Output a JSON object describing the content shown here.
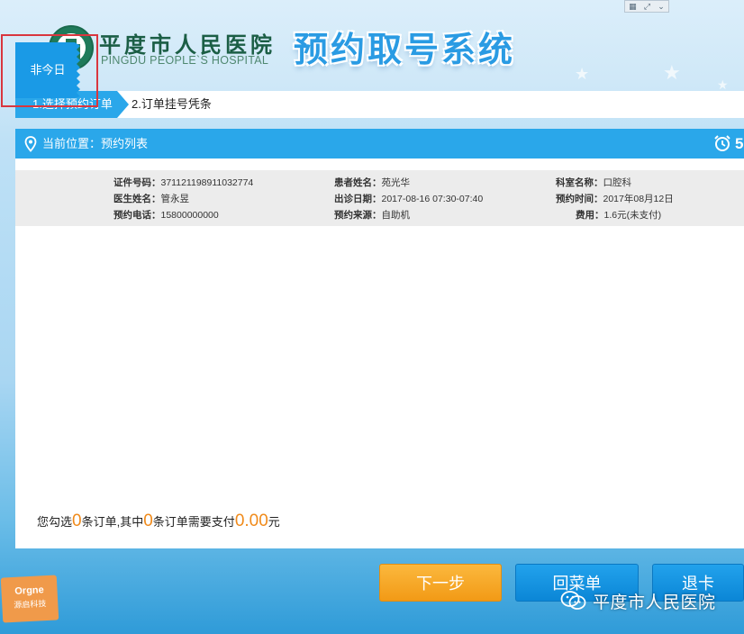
{
  "header": {
    "hospital_name_cn": "平度市人民医院",
    "hospital_name_en": "PINGDU PEOPLE`S HOSPITAL",
    "system_title": "预约取号系统"
  },
  "steps": [
    {
      "label": "1.选择预约订单",
      "active": true
    },
    {
      "label": "2.订单挂号凭条",
      "active": false
    }
  ],
  "location": {
    "label": "当前位置：",
    "value": "预约列表",
    "countdown": "5"
  },
  "order": {
    "tag": "非今日",
    "fields": [
      {
        "key": "证件号码：",
        "value": "371121198911032774"
      },
      {
        "key": "医生姓名：",
        "value": "管永昱"
      },
      {
        "key": "预约电话：",
        "value": "15800000000"
      },
      {
        "key": "患者姓名：",
        "value": "苑光华"
      },
      {
        "key": "出诊日期：",
        "value": "2017-08-16 07:30-07:40"
      },
      {
        "key": "预约来源：",
        "value": "自助机"
      },
      {
        "key": "科室名称：",
        "value": "口腔科"
      },
      {
        "key": "预约时间：",
        "value": "2017年08月12日"
      },
      {
        "key": "费用：",
        "value": "1.6元(未支付)"
      }
    ]
  },
  "summary": {
    "p1": "您勾选",
    "selected_count": "0",
    "p2": "条订单,其中",
    "unpaid_count": "0",
    "p3": "条订单需要支付",
    "amount": "0.00",
    "p4": "元"
  },
  "buttons": {
    "next": "下一步",
    "menu": "回菜单",
    "exit": "退卡"
  },
  "branding": {
    "line1": "Orgne",
    "line2": "源启科技"
  },
  "watermark": {
    "text": "平度市人民医院"
  },
  "colors": {
    "primary_blue": "#2aa7ea",
    "tag_blue": "#1a9ae6",
    "orange": "#f29a16",
    "highlight_red": "#d9363e"
  }
}
